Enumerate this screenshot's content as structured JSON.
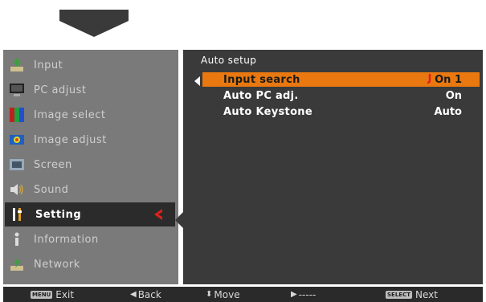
{
  "menu": {
    "items": [
      {
        "label": "Input",
        "icon": "input-icon"
      },
      {
        "label": "PC adjust",
        "icon": "pc-adjust-icon"
      },
      {
        "label": "Image select",
        "icon": "image-select-icon"
      },
      {
        "label": "Image adjust",
        "icon": "image-adjust-icon"
      },
      {
        "label": "Screen",
        "icon": "screen-icon"
      },
      {
        "label": "Sound",
        "icon": "sound-icon"
      },
      {
        "label": "Setting",
        "icon": "setting-icon"
      },
      {
        "label": "Information",
        "icon": "information-icon"
      },
      {
        "label": "Network",
        "icon": "network-icon"
      }
    ],
    "selected_index": 6
  },
  "submenu": {
    "title": "Auto setup",
    "rows": [
      {
        "label": "Input search",
        "value": "On 1"
      },
      {
        "label": "Auto PC adj.",
        "value": "On"
      },
      {
        "label": "Auto Keystone",
        "value": "Auto"
      }
    ]
  },
  "bottom_bar": {
    "exit_key": "MENU",
    "exit": "Exit",
    "back": "Back",
    "move": "Move",
    "next_blank": "-----",
    "next_key": "SELECT",
    "next": "Next"
  },
  "colors": {
    "highlight": "#e8780f",
    "mark": "#e0201a",
    "menu_bg": "#7a7a7a",
    "panel_bg": "#3a3a3a"
  }
}
